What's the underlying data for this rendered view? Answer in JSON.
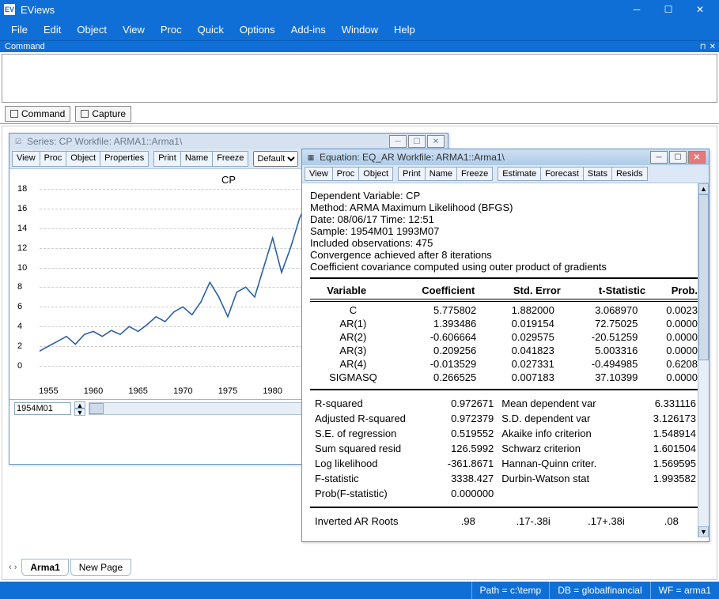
{
  "app": {
    "title": "EViews"
  },
  "menu": [
    "File",
    "Edit",
    "Object",
    "View",
    "Proc",
    "Quick",
    "Options",
    "Add-ins",
    "Window",
    "Help"
  ],
  "command": {
    "label": "Command",
    "capture": "Capture"
  },
  "series_window": {
    "title": "Series: CP   Workfile: ARMA1::Arma1\\",
    "toolbar": [
      "View",
      "Proc",
      "Object",
      "Properties"
    ],
    "toolbar2": [
      "Print",
      "Name",
      "Freeze"
    ],
    "mode": "Default",
    "chart_title": "CP",
    "nav_value": "1954M01"
  },
  "equation_window": {
    "title": "Equation: EQ_AR   Workfile: ARMA1::Arma1\\",
    "toolbar": [
      "View",
      "Proc",
      "Object"
    ],
    "toolbar2": [
      "Print",
      "Name",
      "Freeze"
    ],
    "toolbar3": [
      "Estimate",
      "Forecast",
      "Stats",
      "Resids"
    ],
    "header": [
      "Dependent Variable: CP",
      "Method: ARMA Maximum Likelihood (BFGS)",
      "Date: 08/06/17   Time: 12:51",
      "Sample: 1954M01 1993M07",
      "Included observations: 475",
      "Convergence achieved after 8 iterations",
      "Coefficient covariance computed using outer product of gradients"
    ],
    "col_headers": [
      "Variable",
      "Coefficient",
      "Std. Error",
      "t-Statistic",
      "Prob."
    ],
    "rows": [
      {
        "v": "C",
        "c": "5.775802",
        "s": "1.882000",
        "t": "3.068970",
        "p": "0.0023"
      },
      {
        "v": "AR(1)",
        "c": "1.393486",
        "s": "0.019154",
        "t": "72.75025",
        "p": "0.0000"
      },
      {
        "v": "AR(2)",
        "c": "-0.606664",
        "s": "0.029575",
        "t": "-20.51259",
        "p": "0.0000"
      },
      {
        "v": "AR(3)",
        "c": "0.209256",
        "s": "0.041823",
        "t": "5.003316",
        "p": "0.0000"
      },
      {
        "v": "AR(4)",
        "c": "-0.013529",
        "s": "0.027331",
        "t": "-0.494985",
        "p": "0.6208"
      },
      {
        "v": "SIGMASQ",
        "c": "0.266525",
        "s": "0.007183",
        "t": "37.10399",
        "p": "0.0000"
      }
    ],
    "stats": [
      {
        "l": "R-squared",
        "lv": "0.972671",
        "r": "Mean dependent var",
        "rv": "6.331116"
      },
      {
        "l": "Adjusted R-squared",
        "lv": "0.972379",
        "r": "S.D. dependent var",
        "rv": "3.126173"
      },
      {
        "l": "S.E. of regression",
        "lv": "0.519552",
        "r": "Akaike info criterion",
        "rv": "1.548914"
      },
      {
        "l": "Sum squared resid",
        "lv": "126.5992",
        "r": "Schwarz criterion",
        "rv": "1.601504"
      },
      {
        "l": "Log likelihood",
        "lv": "-361.8671",
        "r": "Hannan-Quinn criter.",
        "rv": "1.569595"
      },
      {
        "l": "F-statistic",
        "lv": "3338.427",
        "r": "Durbin-Watson stat",
        "rv": "1.993582"
      },
      {
        "l": "Prob(F-statistic)",
        "lv": "0.000000",
        "r": "",
        "rv": ""
      }
    ],
    "roots": {
      "label": "Inverted AR Roots",
      "v1": ".98",
      "v2": ".17-.38i",
      "v3": ".17+.38i",
      "v4": ".08"
    }
  },
  "workfile_tabs": {
    "active": "Arma1",
    "new": "New Page"
  },
  "statusbar": {
    "path": "Path = c:\\temp",
    "db": "DB = globalfinancial",
    "wf": "WF = arma1"
  },
  "chart_data": {
    "type": "line",
    "title": "CP",
    "xlabel": "",
    "ylabel": "",
    "x_ticks": [
      "1955",
      "1960",
      "1965",
      "1970",
      "1975",
      "1980"
    ],
    "y_ticks": [
      0,
      2,
      4,
      6,
      8,
      10,
      12,
      14,
      16,
      18
    ],
    "ylim": [
      0,
      18
    ],
    "xrange": [
      "1954M01",
      "1993M07"
    ],
    "series": [
      {
        "name": "CP",
        "color": "#2b5fa6",
        "x": [
          1954,
          1955,
          1956,
          1957,
          1958,
          1959,
          1960,
          1961,
          1962,
          1963,
          1964,
          1965,
          1966,
          1967,
          1968,
          1969,
          1970,
          1971,
          1972,
          1973,
          1974,
          1975,
          1976,
          1977,
          1978,
          1979,
          1980,
          1981,
          1982,
          1983,
          1984
        ],
        "y": [
          1.5,
          2.0,
          2.5,
          3.0,
          2.2,
          3.2,
          3.5,
          3.0,
          3.6,
          3.2,
          4.0,
          3.5,
          4.2,
          5.0,
          4.5,
          5.5,
          6.0,
          5.2,
          6.5,
          8.5,
          7.0,
          5.0,
          7.5,
          8.0,
          7.0,
          10.0,
          13.0,
          9.5,
          12.0,
          15.0,
          17.0
        ]
      }
    ]
  }
}
